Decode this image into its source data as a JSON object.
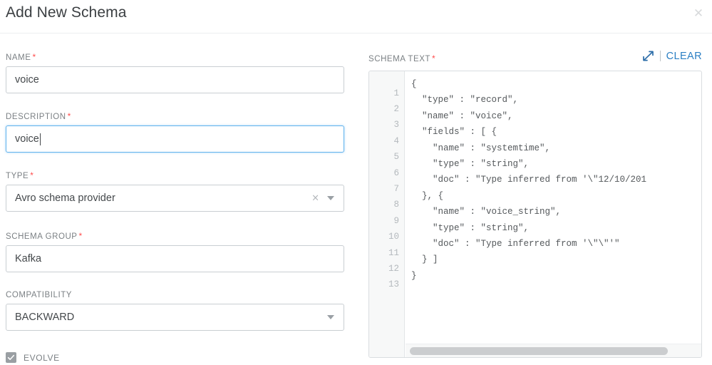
{
  "modal": {
    "title": "Add New Schema",
    "close_icon": "close-icon"
  },
  "form": {
    "name": {
      "label": "NAME",
      "required": "*",
      "value": "voice",
      "placeholder": ""
    },
    "description": {
      "label": "DESCRIPTION",
      "required": "*",
      "value": "voice",
      "placeholder": "",
      "focused": true
    },
    "type": {
      "label": "TYPE",
      "required": "*",
      "value": "Avro schema provider",
      "clear_icon": "×",
      "caret_icon": "chevron-down-icon"
    },
    "schema_group": {
      "label": "SCHEMA GROUP",
      "required": "*",
      "value": "Kafka",
      "placeholder": ""
    },
    "compatibility": {
      "label": "COMPATIBILITY",
      "required": "",
      "value": "BACKWARD",
      "caret_icon": "chevron-down-icon"
    },
    "evolve": {
      "label": "EVOLVE",
      "checked": true
    }
  },
  "schema_text": {
    "label": "SCHEMA TEXT",
    "required": "*",
    "expand_icon": "expand-diagonal-icon",
    "clear_label": "CLEAR",
    "line_numbers": "1\n2\n3\n4\n5\n6\n7\n8\n9\n10\n11\n12\n13",
    "code": "{\n  \"type\" : \"record\",\n  \"name\" : \"voice\",\n  \"fields\" : [ {\n    \"name\" : \"systemtime\",\n    \"type\" : \"string\",\n    \"doc\" : \"Type inferred from '\\\"12/10/201\n  }, {\n    \"name\" : \"voice_string\",\n    \"type\" : \"string\",\n    \"doc\" : \"Type inferred from '\\\"\\\"'\"\n  } ]\n}"
  },
  "colors": {
    "accent": "#2b7fc4",
    "required": "#ff4d4d",
    "label": "#7b8084",
    "border": "#c9ced2",
    "focus_border": "#63b3ed",
    "gutter_bg": "#f7f8f8"
  }
}
